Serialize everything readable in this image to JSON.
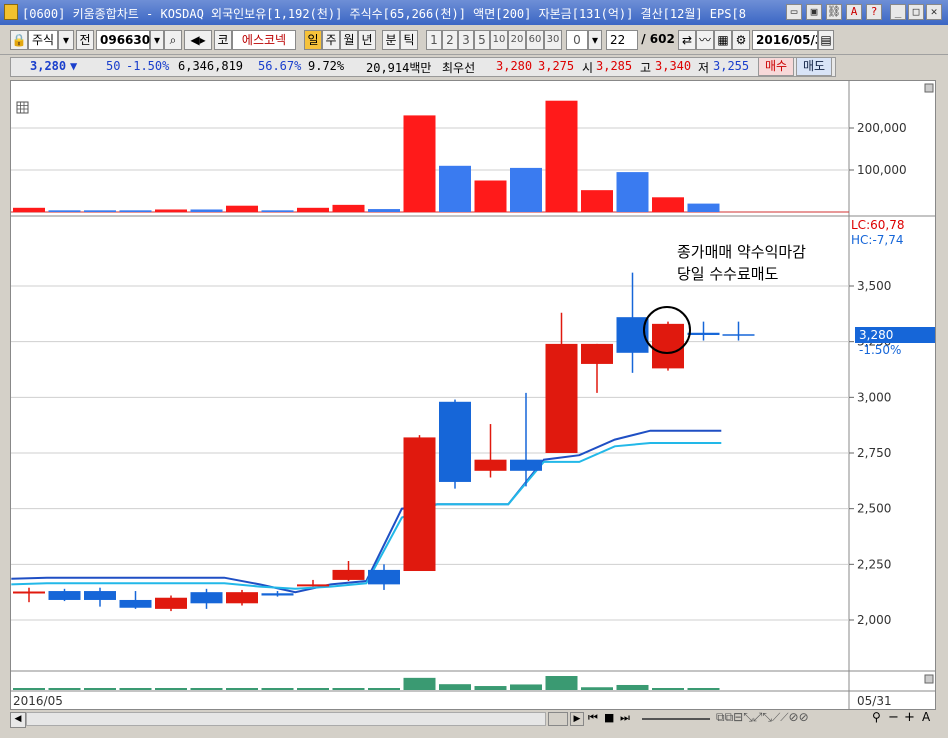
{
  "window": {
    "title": "[0600] 키움종합차트 - KOSDAQ 외국인보유[1,192(천)] 주식수[65,266(천)] 액면[200] 자본금[131(억)] 결산[12월] EPS[8"
  },
  "toolbar": {
    "market": "주식",
    "prev_label": "전",
    "code": "096630",
    "name_prefix": "코",
    "name": "에스코넥",
    "periods": [
      "일",
      "주",
      "월",
      "년",
      "분",
      "틱"
    ],
    "active_period": "일",
    "intervals": [
      "1",
      "2",
      "3",
      "5",
      "10",
      "20",
      "60",
      "30",
      "0"
    ],
    "count": "22",
    "total": "/ 602",
    "date": "2016/05/3"
  },
  "quote": {
    "price": "3,280",
    "arrow": "▼",
    "change": "50",
    "change_pct": "-1.50%",
    "volume": "6,346,819",
    "ratio1": "56.67%",
    "ratio2": "9.72%",
    "amount": "20,914백만",
    "best_label": "최우선",
    "best_ask": "3,280",
    "best_bid": "3,275",
    "open_label": "시",
    "open": "3,285",
    "high_label": "고",
    "high": "3,340",
    "low_label": "저",
    "low": "3,255",
    "buy": "매수",
    "sell": "매도"
  },
  "chart": {
    "annotation_line1": "종가매매 약수익마감",
    "annotation_line2": "당일 수수료매도",
    "lc_label": "LC:60,78",
    "hc_label": "HC:-7,74",
    "current_price": "3,280",
    "current_pct": "-1.50%",
    "date_left": "2016/05",
    "date_right": "05/31",
    "colors": {
      "up": "#e0190e",
      "down": "#1666d8",
      "line1": "#1f4fc4",
      "line2": "#22b8e8",
      "vol_up": "#ff1a1a",
      "vol_down": "#3a7bf0",
      "green": "#3a9a72"
    }
  },
  "chart_data": {
    "type": "candlestick",
    "price_ticks": [
      "3,500",
      "3,250",
      "3,000",
      "2,750",
      "2,500",
      "2,250",
      "2,000"
    ],
    "volume_ticks": [
      "200,000",
      "100,000"
    ],
    "candles": [
      {
        "o": 2128,
        "h": 2145,
        "l": 2080,
        "c": 2128
      },
      {
        "o": 2130,
        "h": 2140,
        "l": 2085,
        "c": 2090
      },
      {
        "o": 2130,
        "h": 2145,
        "l": 2060,
        "c": 2090
      },
      {
        "o": 2090,
        "h": 2130,
        "l": 2050,
        "c": 2055
      },
      {
        "o": 2050,
        "h": 2110,
        "l": 2040,
        "c": 2100
      },
      {
        "o": 2125,
        "h": 2140,
        "l": 2050,
        "c": 2075
      },
      {
        "o": 2075,
        "h": 2135,
        "l": 2065,
        "c": 2125
      },
      {
        "o": 2120,
        "h": 2130,
        "l": 2105,
        "c": 2110
      },
      {
        "o": 2160,
        "h": 2180,
        "l": 2150,
        "c": 2160
      },
      {
        "o": 2180,
        "h": 2265,
        "l": 2175,
        "c": 2225
      },
      {
        "o": 2225,
        "h": 2250,
        "l": 2135,
        "c": 2160
      },
      {
        "o": 2220,
        "h": 2830,
        "l": 2220,
        "c": 2820
      },
      {
        "o": 2980,
        "h": 2990,
        "l": 2590,
        "c": 2620
      },
      {
        "o": 2670,
        "h": 2880,
        "l": 2640,
        "c": 2720
      },
      {
        "o": 2720,
        "h": 3020,
        "l": 2600,
        "c": 2670
      },
      {
        "o": 2750,
        "h": 3380,
        "l": 2750,
        "c": 3240
      },
      {
        "o": 3150,
        "h": 3240,
        "l": 3020,
        "c": 3240
      },
      {
        "o": 3360,
        "h": 3560,
        "l": 3110,
        "c": 3200
      },
      {
        "o": 3130,
        "h": 3340,
        "l": 3120,
        "c": 3330
      },
      {
        "o": 3290,
        "h": 3340,
        "l": 3255,
        "c": 3280
      }
    ],
    "line1": [
      2185,
      2190,
      2190,
      2190,
      2190,
      2190,
      2190,
      2160,
      2125,
      2160,
      2175,
      2500,
      2520,
      2520,
      2520,
      2720,
      2740,
      2810,
      2850,
      2850,
      2850
    ],
    "line2": [
      2160,
      2165,
      2165,
      2165,
      2165,
      2165,
      2165,
      2150,
      2140,
      2150,
      2165,
      2460,
      2520,
      2520,
      2520,
      2710,
      2710,
      2780,
      2795,
      2795,
      2795
    ],
    "volume": [
      10000,
      4000,
      4000,
      4000,
      6000,
      6000,
      15000,
      4000,
      10000,
      17000,
      7000,
      230000,
      110000,
      75000,
      105000,
      265000,
      52000,
      95000,
      35000,
      20000
    ]
  }
}
